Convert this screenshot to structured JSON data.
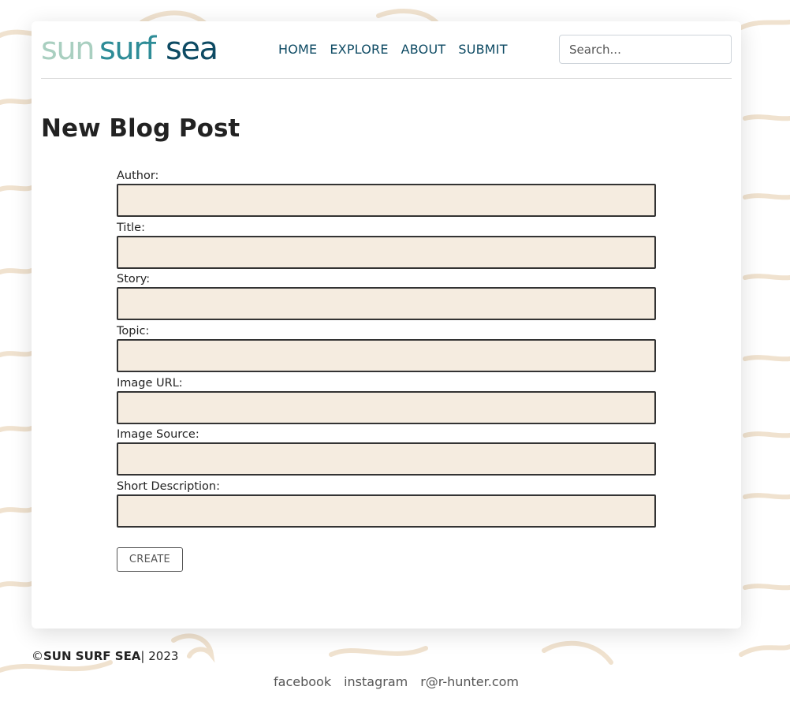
{
  "colors": {
    "brand_dark": "#0d4a63",
    "brand_teal": "#2e8c97",
    "brand_light": "#a9cfc0",
    "field_bg": "#f5ece0",
    "wave": "#f0e2cf"
  },
  "header": {
    "logo": {
      "word1": "sun",
      "word2": "surf",
      "word3": "sea"
    },
    "nav": [
      {
        "label": "HOME"
      },
      {
        "label": "EXPLORE"
      },
      {
        "label": "ABOUT"
      },
      {
        "label": "SUBMIT"
      }
    ],
    "search": {
      "placeholder": "Search...",
      "value": ""
    }
  },
  "main": {
    "title": "New Blog Post",
    "fields": [
      {
        "label": "Author:",
        "value": ""
      },
      {
        "label": "Title:",
        "value": ""
      },
      {
        "label": "Story:",
        "value": ""
      },
      {
        "label": "Topic:",
        "value": ""
      },
      {
        "label": "Image URL:",
        "value": ""
      },
      {
        "label": "Image Source:",
        "value": ""
      },
      {
        "label": "Short Description:",
        "value": ""
      }
    ],
    "create_label": "CREATE"
  },
  "footer": {
    "copyright_symbol": "©",
    "brand": "SUN SURF SEA",
    "year_text": "| 2023",
    "links": [
      {
        "label": "facebook"
      },
      {
        "label": "instagram"
      },
      {
        "label": "r@r-hunter.com"
      }
    ]
  }
}
